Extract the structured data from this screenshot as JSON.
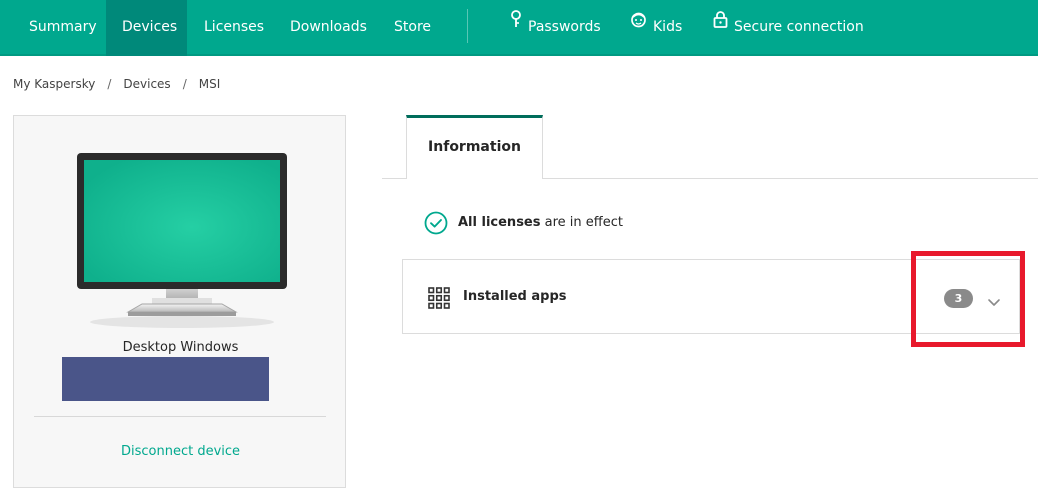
{
  "nav": {
    "items": [
      {
        "label": "Summary"
      },
      {
        "label": "Devices",
        "active": true
      },
      {
        "label": "Licenses"
      },
      {
        "label": "Downloads"
      },
      {
        "label": "Store"
      }
    ],
    "services": [
      {
        "label": "Passwords",
        "icon": "key-icon"
      },
      {
        "label": "Kids",
        "icon": "kids-face-icon"
      },
      {
        "label": "Secure connection",
        "icon": "lock-icon"
      }
    ],
    "bg_color": "#00a88e",
    "active_color": "#00897a"
  },
  "breadcrumb": [
    "My Kaspersky",
    "Devices",
    "MSI"
  ],
  "device": {
    "name": "Desktop Windows",
    "icon": "desktop-monitor-icon",
    "disconnect_label": "Disconnect device"
  },
  "tabs": [
    {
      "label": "Information",
      "active": true
    }
  ],
  "license_status": {
    "icon": "check-circle-icon",
    "bold": "All licenses",
    "rest": " are in effect"
  },
  "installed_apps": {
    "icon": "grid-icon",
    "title": "Installed apps",
    "count": "3",
    "highlight_color": "#e8192c"
  }
}
